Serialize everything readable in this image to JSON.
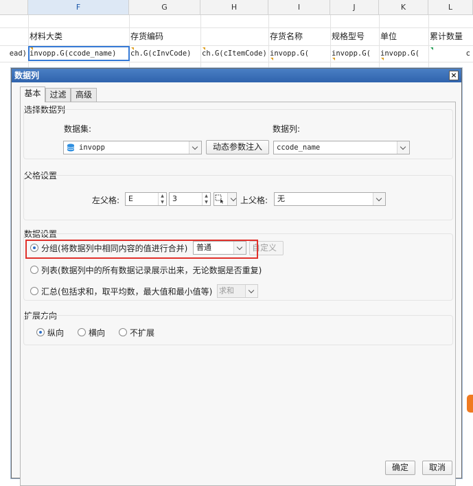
{
  "sheet": {
    "columns": [
      {
        "letter": "F",
        "selected": true
      },
      {
        "letter": "G",
        "selected": false
      },
      {
        "letter": "H",
        "selected": false
      },
      {
        "letter": "I",
        "selected": false
      },
      {
        "letter": "J",
        "selected": false
      },
      {
        "letter": "K",
        "selected": false
      },
      {
        "letter": "L",
        "selected": false
      }
    ],
    "header_row": {
      "F": "材料大类",
      "G": "存货编码",
      "H": "",
      "I": "存货名称",
      "J": "规格型号",
      "K": "单位",
      "L": "累计数量"
    },
    "formula_row": {
      "E": "ead)",
      "F": "invopp.G(ccode_name)",
      "G": "ch.G(cInvCode)",
      "H": "ch.G(cItemCode)",
      "I": "invopp.G(",
      "J": "invopp.G(",
      "K": "invopp.G(",
      "L": "c"
    }
  },
  "dialog": {
    "title": "数据列",
    "close_glyph": "×",
    "tabs": [
      "基本",
      "过滤",
      "高级"
    ],
    "select_column": {
      "title": "选择数据列",
      "dataset_label": "数据集:",
      "dataset_value": "invopp",
      "param_button": "动态参数注入",
      "column_label": "数据列:",
      "column_value": "ccode_name"
    },
    "parent_cell": {
      "title": "父格设置",
      "left_label": "左父格:",
      "left_col": "E",
      "left_row": "3",
      "upper_label": "上父格:",
      "upper_value": "无"
    },
    "data_setting": {
      "title": "数据设置",
      "group_label": "分组(将数据列中相同内容的值进行合并)",
      "group_mode": "普通",
      "custom_button": "自定义",
      "list_label": "列表(数据列中的所有数据记录展示出来，无论数据是否重复)",
      "summary_label": "汇总(包括求和，取平均数，最大值和最小值等)",
      "summary_mode": "求和",
      "selected": "group"
    },
    "expand": {
      "title": "扩展方向",
      "options": [
        "纵向",
        "横向",
        "不扩展"
      ],
      "selected": "纵向"
    },
    "ok_button": "确定",
    "cancel_button": "取消"
  },
  "colors": {
    "accent": "#2f6fc6",
    "highlight_box": "#e0302a",
    "titlebar": "#2f63ad"
  }
}
